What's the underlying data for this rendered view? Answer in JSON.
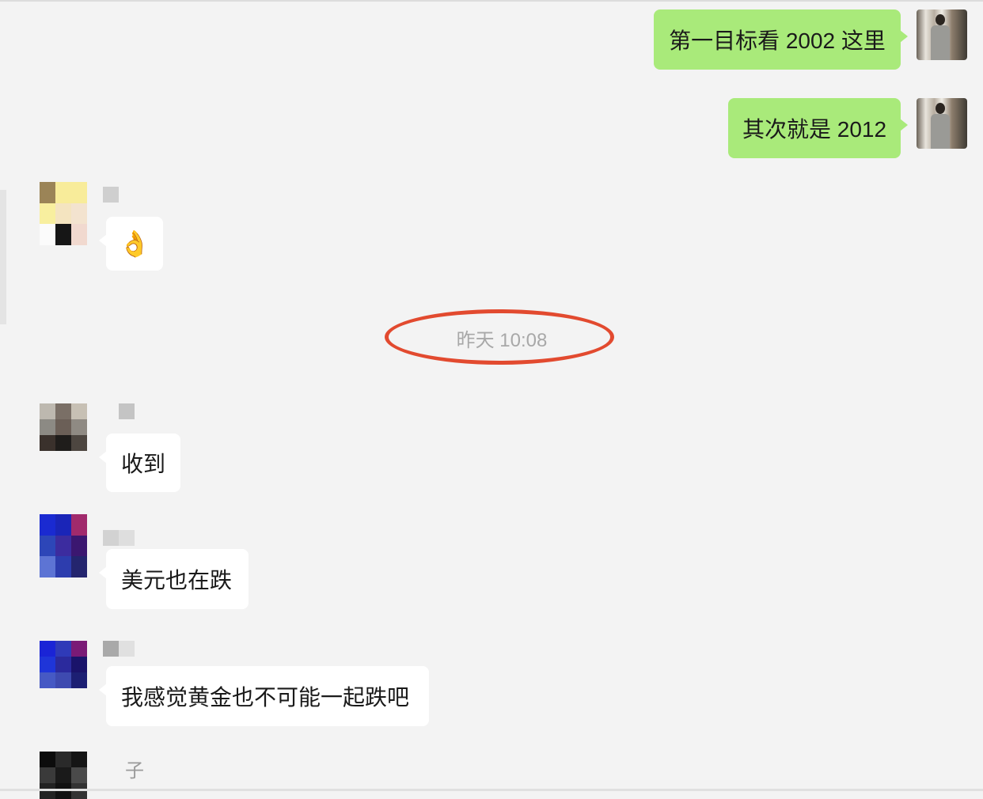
{
  "messages": [
    {
      "side": "me",
      "text": "第一目标看 2002 这里"
    },
    {
      "side": "me",
      "text": "其次就是 2012"
    },
    {
      "side": "other",
      "text": "👌"
    },
    {
      "side": "other",
      "text": "收到"
    },
    {
      "side": "other",
      "text": "美元也在跌"
    },
    {
      "side": "other",
      "text": "我感觉黄金也不可能一起跌吧"
    }
  ],
  "timestamp": "昨天 10:08",
  "partial_sender_name": "子",
  "colors": {
    "background": "#f3f3f3",
    "bubble_me": "#a9ea7a",
    "bubble_other": "#ffffff",
    "timestamp_text": "#a8a8a8",
    "annotation_ring": "#e24a2f"
  }
}
